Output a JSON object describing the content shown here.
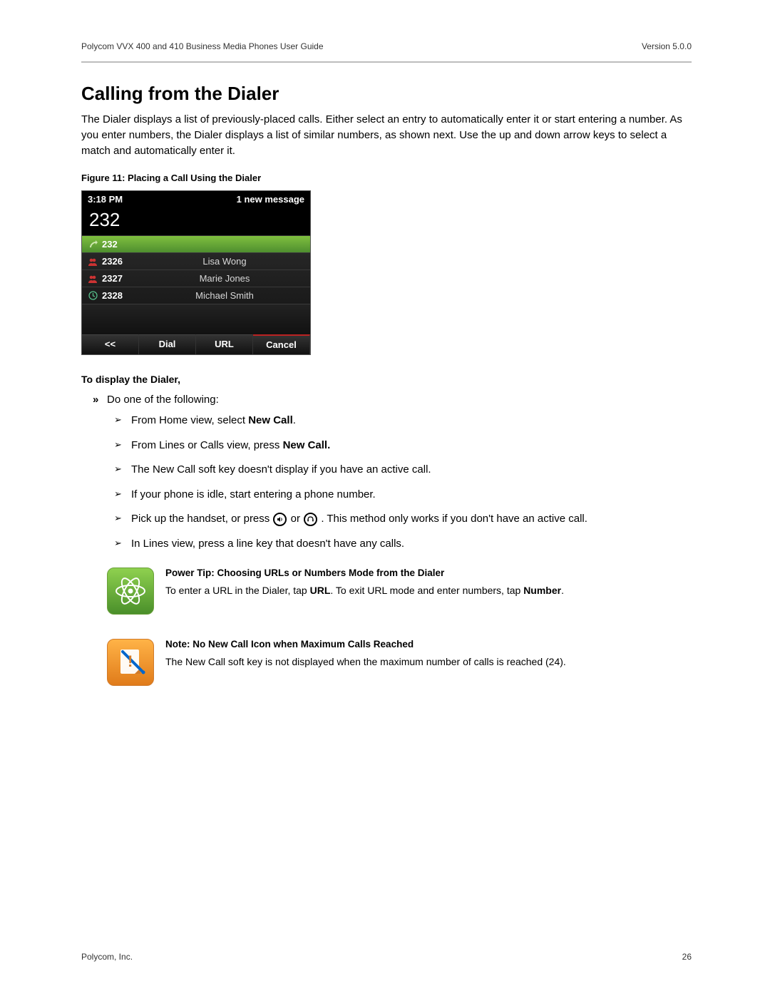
{
  "header": {
    "left": "Polycom VVX 400 and 410 Business Media Phones User Guide",
    "right": "Version 5.0.0"
  },
  "section": {
    "title": "Calling from the Dialer",
    "intro": "The Dialer displays a list of previously-placed calls. Either select an entry to automatically enter it or start entering a number. As you enter numbers, the Dialer displays a list of similar numbers, as shown next. Use the up and down arrow keys to select a match and automatically enter it."
  },
  "figure": {
    "caption": "Figure 11: Placing a Call Using the Dialer",
    "phone": {
      "time": "3:18 PM",
      "status_right": "1 new message",
      "entered": "232",
      "entries": [
        {
          "icon": "placed-call",
          "number": "232",
          "name": "",
          "selected": true
        },
        {
          "icon": "contact",
          "number": "2326",
          "name": "Lisa Wong",
          "selected": false
        },
        {
          "icon": "contact",
          "number": "2327",
          "name": "Marie Jones",
          "selected": false
        },
        {
          "icon": "clock",
          "number": "2328",
          "name": "Michael Smith",
          "selected": false
        }
      ],
      "softkeys": {
        "back": "<<",
        "dial": "Dial",
        "url": "URL",
        "cancel": "Cancel"
      }
    }
  },
  "dialer_heading": "To display the Dialer,",
  "top_item": "Do one of the following:",
  "steps": [
    {
      "pre": "From Home view, select ",
      "bold": "New Call",
      "post": "."
    },
    {
      "pre": "From Lines or Calls view, press ",
      "bold": "New Call.",
      "post": ""
    },
    {
      "pre": "The New Call soft key doesn't display if you have an active call.",
      "bold": "",
      "post": ""
    },
    {
      "pre": "If your phone is idle, start entering a phone number.",
      "bold": "",
      "post": ""
    },
    {
      "pre_a": "Pick up the handset, or press ",
      "mid": " or ",
      "post_a": ". This method only works if you don't have an active call."
    },
    {
      "pre": "In Lines view, press a line key that doesn't have any calls.",
      "bold": "",
      "post": ""
    }
  ],
  "tip": {
    "title": "Power Tip: Choosing URLs or Numbers Mode from the Dialer",
    "pre": "To enter a URL in the Dialer, tap ",
    "b1": "URL",
    "mid": ". To exit URL mode and enter numbers, tap ",
    "b2": "Number",
    "post": "."
  },
  "note": {
    "title": "Note: No New Call Icon when Maximum Calls Reached",
    "body": "The New Call soft key is not displayed when the maximum number of calls is reached (24)."
  },
  "footer": {
    "left": "Polycom, Inc.",
    "right": "26"
  }
}
